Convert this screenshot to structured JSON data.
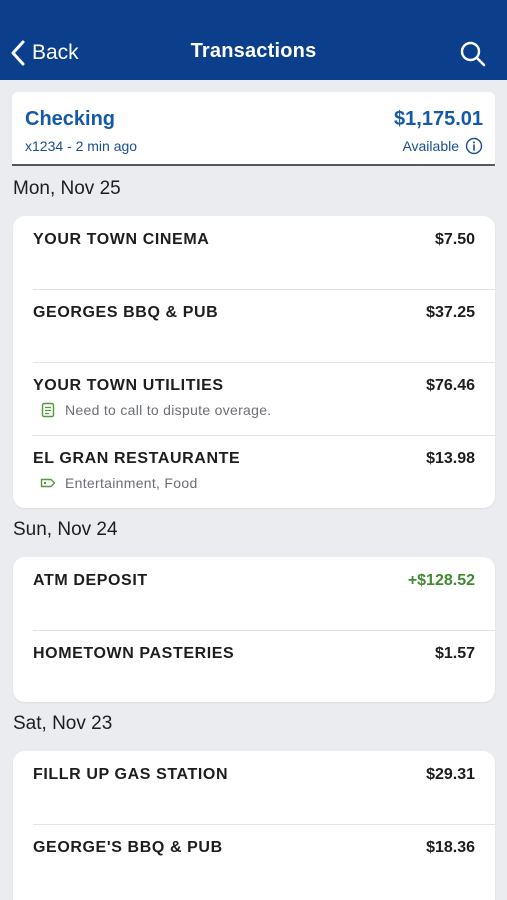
{
  "colors": {
    "nav_bar": "#0b3f8c",
    "account_text": "#1659a7",
    "deposit_green": "#3f8a2e",
    "note_icon_green": "#4f9a3c",
    "background": "#eaecef"
  },
  "nav": {
    "back_icon": "chevron-left-icon",
    "back_label": "Back",
    "title": "Transactions",
    "search_icon": "search-icon"
  },
  "account": {
    "name": "Checking",
    "subtitle": "x1234 - 2 min ago",
    "balance": "$1,175.01",
    "available_label": "Available",
    "info_icon": "info-icon"
  },
  "groups": [
    {
      "date": "Mon, Nov 25",
      "transactions": [
        {
          "merchant": "YOUR TOWN CINEMA",
          "amount": "$7.50"
        },
        {
          "merchant": "GEORGES BBQ & PUB",
          "amount": "$37.25"
        },
        {
          "merchant": "YOUR TOWN UTILITIES",
          "amount": "$76.46",
          "note_icon": "memo-icon",
          "note": "Need to call to dispute overage."
        },
        {
          "merchant": "EL GRAN RESTAURANTE",
          "amount": "$13.98",
          "note_icon": "tag-icon",
          "note": "Entertainment, Food"
        }
      ]
    },
    {
      "date": "Sun, Nov 24",
      "transactions": [
        {
          "merchant": "ATM DEPOSIT",
          "amount": "+$128.52"
        },
        {
          "merchant": "HOMETOWN PASTERIES",
          "amount": "$1.57"
        }
      ]
    },
    {
      "date": "Sat, Nov 23",
      "transactions": [
        {
          "merchant": "FILLR UP GAS STATION",
          "amount": "$29.31"
        },
        {
          "merchant": "GEORGE'S BBQ & PUB",
          "amount": "$18.36"
        }
      ]
    }
  ]
}
